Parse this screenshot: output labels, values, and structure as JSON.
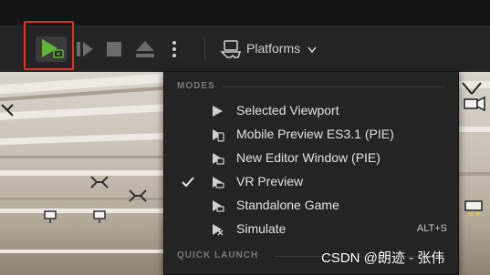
{
  "toolbar": {
    "buttons": [
      {
        "name": "play",
        "icon": "play-icon",
        "color": "#5fb832"
      },
      {
        "name": "play-options",
        "icon": "chevron-play-icon"
      },
      {
        "name": "stop",
        "icon": "stop-icon"
      },
      {
        "name": "eject",
        "icon": "eject-icon"
      },
      {
        "name": "more",
        "icon": "more-vertical-icon"
      }
    ],
    "platforms_label": "Platforms",
    "highlight_color": "#e0322a"
  },
  "menu": {
    "modes_header": "MODES",
    "items": [
      {
        "label": "Selected Viewport",
        "icon": "selected-viewport-icon",
        "checked": false,
        "shortcut": ""
      },
      {
        "label": "Mobile Preview ES3.1 (PIE)",
        "icon": "mobile-preview-icon",
        "checked": false,
        "shortcut": ""
      },
      {
        "label": "New Editor Window (PIE)",
        "icon": "new-window-icon",
        "checked": false,
        "shortcut": ""
      },
      {
        "label": "VR Preview",
        "icon": "vr-preview-icon",
        "checked": true,
        "shortcut": ""
      },
      {
        "label": "Standalone Game",
        "icon": "standalone-game-icon",
        "checked": false,
        "shortcut": ""
      },
      {
        "label": "Simulate",
        "icon": "simulate-icon",
        "checked": false,
        "shortcut": "ALT+S"
      }
    ],
    "quick_launch_header": "QUICK LAUNCH"
  },
  "watermark": "CSDN @朗迹 - 张伟"
}
